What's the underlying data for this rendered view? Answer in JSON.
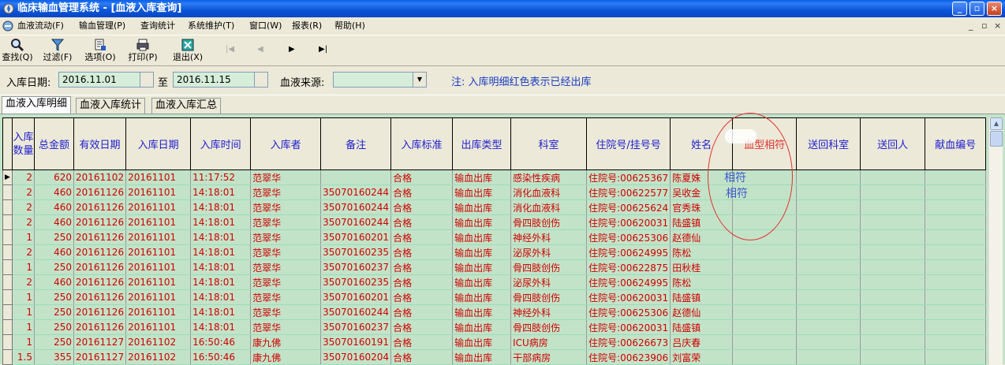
{
  "window": {
    "title": "临床输血管理系统 - [血液入库查询]"
  },
  "menubar": {
    "items": [
      "血液流动(F)",
      "输血管理(P)",
      "查询统计",
      "系统维护(T)",
      "窗口(W)",
      "报表(R)",
      "帮助(H)"
    ],
    "mdi_min": "_",
    "mdi_restore": "▫",
    "mdi_close": "×"
  },
  "toolbar": {
    "find_label": "查找(Q)",
    "filter_label": "过滤(F)",
    "options_label": "选项(O)",
    "print_label": "打印(P)",
    "exit_label": "退出(X)",
    "nav_first": "|◀",
    "nav_prev": "◀",
    "nav_next": "▶",
    "nav_last": "▶|"
  },
  "filter": {
    "date_label": "入库日期:",
    "date_from": "2016.11.01",
    "date_sep": "至",
    "date_to": "2016.11.15",
    "source_label": "血液来源:",
    "source_value": "",
    "note": "注: 入库明细红色表示已经出库"
  },
  "tabs": [
    "血液入库明细",
    "血液入库统计",
    "血液入库汇总"
  ],
  "grid": {
    "columns": [
      "入库数量",
      "总金额",
      "有效日期",
      "入库日期",
      "入库时间",
      "入库者",
      "备注",
      "入库标准",
      "出库类型",
      "科室",
      "住院号/挂号号",
      "姓名",
      "血型相符",
      "送回科室",
      "送回人",
      "献血编号"
    ],
    "rows": [
      [
        "2",
        "620",
        "20161102",
        "20161101",
        "11:17:52",
        "范翠华",
        "",
        "合格",
        "输血出库",
        "感染性疾病",
        "住院号:00625367",
        "陈夏姝"
      ],
      [
        "2",
        "460",
        "20161126",
        "20161101",
        "14:18:01",
        "范翠华",
        "35070160244",
        "合格",
        "输血出库",
        "消化血液科",
        "住院号:00622577",
        "吴收金"
      ],
      [
        "2",
        "460",
        "20161126",
        "20161101",
        "14:18:01",
        "范翠华",
        "35070160244",
        "合格",
        "输血出库",
        "消化血液科",
        "住院号:00625624",
        "官秀珠"
      ],
      [
        "2",
        "460",
        "20161126",
        "20161101",
        "14:18:01",
        "范翠华",
        "35070160244",
        "合格",
        "输血出库",
        "骨四肢创伤",
        "住院号:00620031",
        "陆盛镇"
      ],
      [
        "1",
        "250",
        "20161126",
        "20161101",
        "14:18:01",
        "范翠华",
        "35070160201",
        "合格",
        "输血出库",
        "神经外科",
        "住院号:00625306",
        "赵德仙"
      ],
      [
        "2",
        "460",
        "20161126",
        "20161101",
        "14:18:01",
        "范翠华",
        "35070160235",
        "合格",
        "输血出库",
        "泌尿外科",
        "住院号:00624995",
        "陈松"
      ],
      [
        "1",
        "250",
        "20161126",
        "20161101",
        "14:18:01",
        "范翠华",
        "35070160237",
        "合格",
        "输血出库",
        "骨四肢创伤",
        "住院号:00622875",
        "田秋桂"
      ],
      [
        "2",
        "460",
        "20161126",
        "20161101",
        "14:18:01",
        "范翠华",
        "35070160235",
        "合格",
        "输血出库",
        "泌尿外科",
        "住院号:00624995",
        "陈松"
      ],
      [
        "1",
        "250",
        "20161126",
        "20161101",
        "14:18:01",
        "范翠华",
        "35070160201",
        "合格",
        "输血出库",
        "骨四肢创伤",
        "住院号:00620031",
        "陆盛镇"
      ],
      [
        "1",
        "250",
        "20161126",
        "20161101",
        "14:18:01",
        "范翠华",
        "35070160244",
        "合格",
        "输血出库",
        "神经外科",
        "住院号:00625306",
        "赵德仙"
      ],
      [
        "1",
        "250",
        "20161126",
        "20161101",
        "14:18:01",
        "范翠华",
        "35070160237",
        "合格",
        "输血出库",
        "骨四肢创伤",
        "住院号:00620031",
        "陆盛镇"
      ],
      [
        "1",
        "250",
        "20161127",
        "20161102",
        "16:50:46",
        "康九佛",
        "35070160191",
        "合格",
        "输血出库",
        "ICU病房",
        "住院号:00626673",
        "吕庆春"
      ],
      [
        "1.5",
        "355",
        "20161127",
        "20161102",
        "16:50:46",
        "康九佛",
        "35070160204",
        "合格",
        "输血出库",
        "干部病房",
        "住院号:00623906",
        "刘富荣"
      ]
    ],
    "blood_match": [
      "相符",
      "相符"
    ]
  },
  "colors": {
    "shipped_text": "#d00000",
    "grid_background": "#c3e3c8",
    "header_text": "#2020d0",
    "annotation": "#e03030"
  }
}
